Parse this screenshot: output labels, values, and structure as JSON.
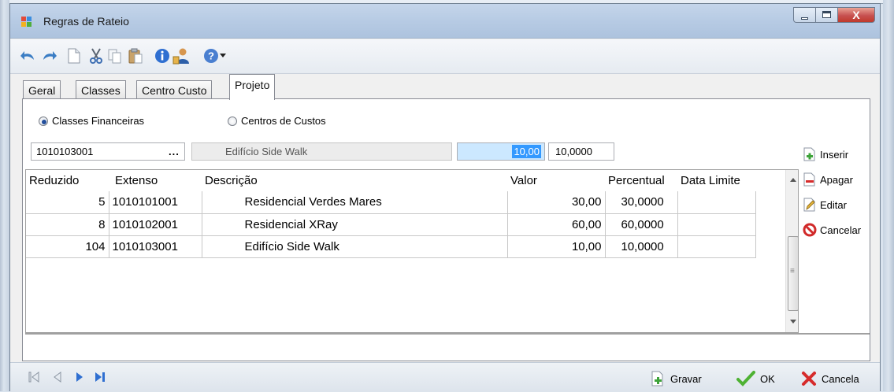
{
  "window": {
    "title": "Regras de Rateio",
    "close_glyph": "X"
  },
  "toolbar": {
    "icons": [
      "undo-icon",
      "redo-icon",
      "new-document-icon",
      "cut-icon",
      "copy-icon",
      "paste-icon",
      "info-icon",
      "user-icon",
      "help-icon",
      "dropdown-icon"
    ]
  },
  "tabs": [
    {
      "label": "Geral"
    },
    {
      "label": "Classes"
    },
    {
      "label": "Centro Custo"
    },
    {
      "label": "Projeto",
      "active": true
    }
  ],
  "options": {
    "classes": "Classes Financeiras",
    "centros": "Centros de Custos",
    "selected": "classes"
  },
  "entry": {
    "code": "1010103001",
    "lookup": "...",
    "description": "Edifício Side Walk",
    "valor": "10,00",
    "percentual": "10,0000"
  },
  "grid": {
    "columns": [
      "Reduzido",
      "Extenso",
      "Descrição",
      "Valor",
      "Percentual",
      "Data Limite"
    ],
    "rows": [
      [
        "5",
        "1010101001",
        "Residencial Verdes Mares",
        "30,00",
        "30,0000",
        ""
      ],
      [
        "8",
        "1010102001",
        "Residencial XRay",
        "60,00",
        "60,0000",
        ""
      ],
      [
        "104",
        "1010103001",
        "Edifício Side Walk",
        "10,00",
        "10,0000",
        ""
      ]
    ],
    "scroll_thumb_glyph": "≡"
  },
  "actions": {
    "inserir": "Inserir",
    "apagar": "Apagar",
    "editar": "Editar",
    "cancelar": "Cancelar"
  },
  "footer": {
    "gravar": "Gravar",
    "ok": "OK",
    "cancela": "Cancela"
  },
  "colors": {
    "accent": "#3399ff",
    "titlebar": "#b7cbe4",
    "close": "#c75050"
  }
}
